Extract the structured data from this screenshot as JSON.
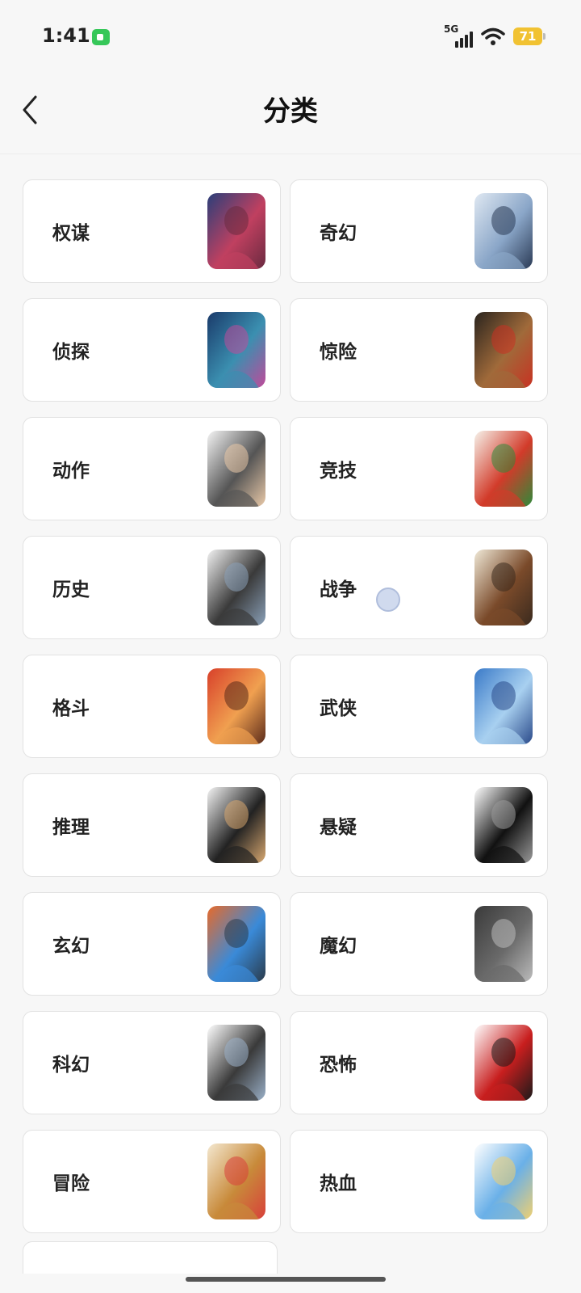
{
  "status_bar": {
    "time": "1:41",
    "network": "5G",
    "battery": "71",
    "colors": {
      "facetime": "#36c759",
      "battery": "#f1c232"
    }
  },
  "header": {
    "title": "分类",
    "back_icon": "chevron-left-icon"
  },
  "categories": [
    {
      "label": "权谋",
      "thumb_colors": [
        "#2a3f7a",
        "#c04060",
        "#6a2a40"
      ]
    },
    {
      "label": "奇幻",
      "thumb_colors": [
        "#dfe8f2",
        "#8aa6c8",
        "#2a3a55"
      ]
    },
    {
      "label": "侦探",
      "thumb_colors": [
        "#1a3a6a",
        "#3b8fb0",
        "#c04a9a"
      ]
    },
    {
      "label": "惊险",
      "thumb_colors": [
        "#2a241e",
        "#a06a3a",
        "#c83222"
      ]
    },
    {
      "label": "动作",
      "thumb_colors": [
        "#f4f4f4",
        "#555555",
        "#e9c9a8"
      ]
    },
    {
      "label": "竞技",
      "thumb_colors": [
        "#f6f2ea",
        "#d23b2a",
        "#2f8a3a"
      ]
    },
    {
      "label": "历史",
      "thumb_colors": [
        "#f2f2f2",
        "#3a3a3a",
        "#8aa0b8"
      ]
    },
    {
      "label": "战争",
      "thumb_colors": [
        "#efe8d6",
        "#7a4a2a",
        "#3a2a1e"
      ]
    },
    {
      "label": "格斗",
      "thumb_colors": [
        "#d8402a",
        "#f0a050",
        "#5a2a1a"
      ]
    },
    {
      "label": "武侠",
      "thumb_colors": [
        "#3a7ac8",
        "#a8d0f0",
        "#2a4a8a"
      ]
    },
    {
      "label": "推理",
      "thumb_colors": [
        "#f4f4f4",
        "#222222",
        "#d8a870"
      ]
    },
    {
      "label": "悬疑",
      "thumb_colors": [
        "#ffffff",
        "#111111",
        "#9a9a9a"
      ]
    },
    {
      "label": "玄幻",
      "thumb_colors": [
        "#e86a2a",
        "#3a8ad8",
        "#2a3a4a"
      ]
    },
    {
      "label": "魔幻",
      "thumb_colors": [
        "#3a3a3a",
        "#6a6a6a",
        "#bcbcbc"
      ]
    },
    {
      "label": "科幻",
      "thumb_colors": [
        "#ffffff",
        "#3a3a3a",
        "#9ab0c8"
      ]
    },
    {
      "label": "恐怖",
      "thumb_colors": [
        "#ffffff",
        "#c81e1e",
        "#1a1a1a"
      ]
    },
    {
      "label": "冒险",
      "thumb_colors": [
        "#f4e8d0",
        "#c88a3a",
        "#d8403a"
      ]
    },
    {
      "label": "热血",
      "thumb_colors": [
        "#ffffff",
        "#6ab0e8",
        "#f0d070"
      ]
    }
  ]
}
